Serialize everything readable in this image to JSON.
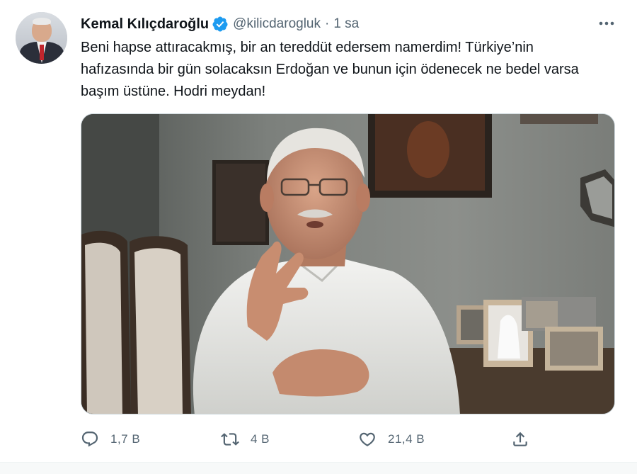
{
  "author": {
    "name": "Kemal Kılıçdaroğlu",
    "handle": "@kilicdarogluk",
    "separator": "·",
    "time": "1 sa",
    "verified_icon": "verified-badge-icon",
    "brand_color": "#1d9bf0"
  },
  "tweet": {
    "text": "Beni hapse attıracakmış, bir an tereddüt edersem namerdim! Türkiye’nin hafızasında bir gün solacaksın Erdoğan ve bunun için ödenecek ne bedel varsa başım üstüne. Hodri meydan!"
  },
  "media": {
    "type": "video-still",
    "icon": "video-thumbnail"
  },
  "actions": {
    "reply": {
      "icon": "reply-icon",
      "count": "1,7 B"
    },
    "retweet": {
      "icon": "retweet-icon",
      "count": "4 B"
    },
    "like": {
      "icon": "heart-icon",
      "count": "21,4 B"
    },
    "share": {
      "icon": "share-icon"
    }
  },
  "more_icon": "more-dots-icon"
}
